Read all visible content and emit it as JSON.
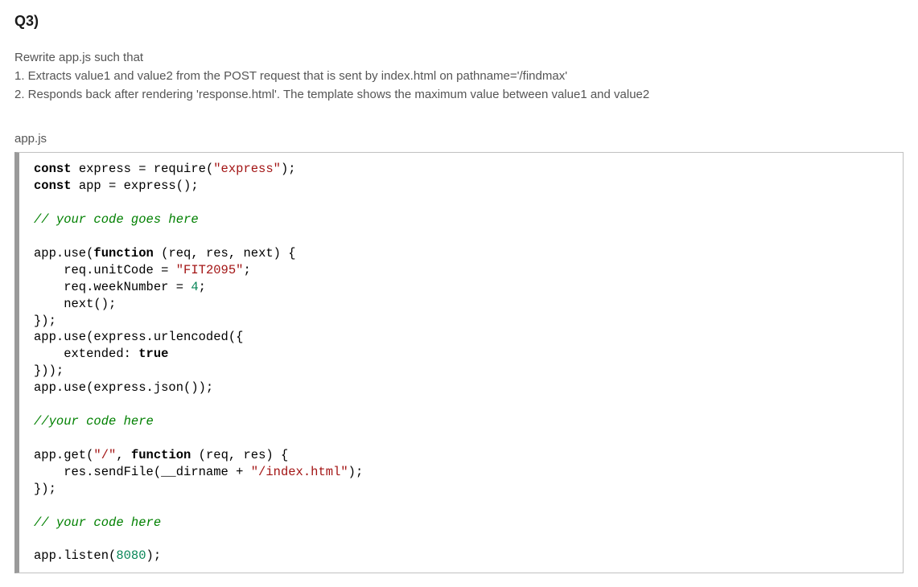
{
  "question": {
    "heading": "Q3)",
    "intro": "Rewrite app.js such that",
    "item1": "1. Extracts value1 and value2 from the POST request that is sent by index.html on pathname='/findmax'",
    "item2": "2. Responds back after rendering 'response.html'. The template shows the maximum value between value1 and value2"
  },
  "filename": "app.js",
  "code": {
    "kw_const1": "const",
    "line1_a": " express = require(",
    "str_express": "\"express\"",
    "line1_b": ");",
    "kw_const2": "const",
    "line2": " app = express();",
    "comment1": "// your code goes here",
    "line4_a": "app.use(",
    "kw_function1": "function",
    "line4_b": " (req, res, next) {",
    "line5_a": "    req.unitCode = ",
    "str_fit": "\"FIT2095\"",
    "line5_b": ";",
    "line6_a": "    req.weekNumber = ",
    "num_4": "4",
    "line6_b": ";",
    "line7": "    next();",
    "line8": "});",
    "line9": "app.use(express.urlencoded({",
    "line10_a": "    extended: ",
    "kw_true": "true",
    "line11": "}));",
    "line12": "app.use(express.json());",
    "comment2": "//your code here",
    "line13_a": "app.get(",
    "str_slash": "\"/\"",
    "line13_b": ", ",
    "kw_function2": "function",
    "line13_c": " (req, res) {",
    "line14_a": "    res.sendFile(__dirname + ",
    "str_index": "\"/index.html\"",
    "line14_b": ");",
    "line15": "});",
    "comment3": "// your code here",
    "line16_a": "app.listen(",
    "num_8080": "8080",
    "line16_b": ");"
  }
}
